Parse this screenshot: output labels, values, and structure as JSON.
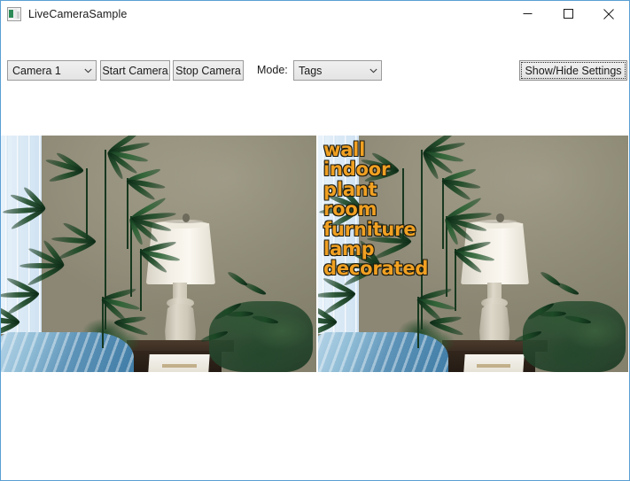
{
  "window": {
    "title": "LiveCameraSample",
    "icon": "camera-app-icon",
    "border_color": "#5a9fd4",
    "caption": {
      "minimize": "minimize-icon",
      "maximize": "maximize-icon",
      "close": "close-icon"
    }
  },
  "toolbar": {
    "camera_select": {
      "value": "Camera 1",
      "arrow": "chevron-down-icon"
    },
    "start_camera_label": "Start Camera",
    "stop_camera_label": "Stop Camera",
    "mode_label": "Mode:",
    "mode_select": {
      "value": "Tags",
      "arrow": "chevron-down-icon"
    },
    "show_hide_settings_label": "Show/Hide Settings"
  },
  "preview": {
    "raw_frame_alt": "Live camera frame showing a lamp on a wooden side table beside indoor palm plants and a window with vertical blinds",
    "tagged_frame_alt": "Same camera frame with computer-vision tag overlay",
    "tag_color": "#f0a022",
    "tag_outline_color": "#1b1b10",
    "tags": [
      "wall",
      "indoor",
      "plant",
      "room",
      "furniture",
      "lamp",
      "decorated"
    ]
  }
}
